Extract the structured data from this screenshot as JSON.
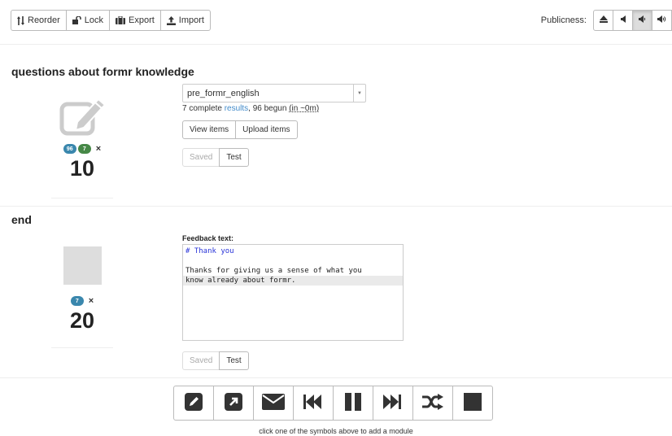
{
  "toolbar": {
    "reorder": "Reorder",
    "lock": "Lock",
    "export": "Export",
    "import": "Import"
  },
  "publicness": {
    "label": "Publicness:",
    "options": [
      "eject-icon",
      "volume-off-icon",
      "volume-down-icon",
      "volume-up-icon"
    ],
    "active_index": 2
  },
  "units": [
    {
      "title": "questions about formr knowledge",
      "icon": "pencil-square-icon",
      "badges": [
        "96",
        "7"
      ],
      "remove": "×",
      "position": "10",
      "survey_select": "pre_formr_english",
      "status": {
        "prefix": "7 complete ",
        "link": "results",
        "middle": ", 96 begun ",
        "time": "(in ~0m)"
      },
      "buttons": [
        "View items",
        "Upload items"
      ],
      "save_test": [
        "Saved",
        "Test"
      ]
    },
    {
      "title": "end",
      "icon": "stop-placeholder",
      "badges": [
        "7"
      ],
      "remove": "×",
      "position": "20",
      "feedback_label": "Feedback text:",
      "feedback_lines": [
        "# Thank you",
        "",
        "Thanks for giving us a sense of what you",
        "know already about formr."
      ],
      "save_test": [
        "Saved",
        "Test"
      ]
    }
  ],
  "modules": {
    "icons": [
      "survey-pencil-icon",
      "external-link-icon",
      "email-icon",
      "skip-backward-icon",
      "pause-icon",
      "skip-forward-icon",
      "shuffle-icon",
      "stop-icon"
    ],
    "hint": "click one of the symbols above to add a module"
  },
  "colors": {
    "badge_blue": "#3a87ad",
    "badge_green": "#468847",
    "link": "#428bca",
    "module_icon": "#333333"
  }
}
